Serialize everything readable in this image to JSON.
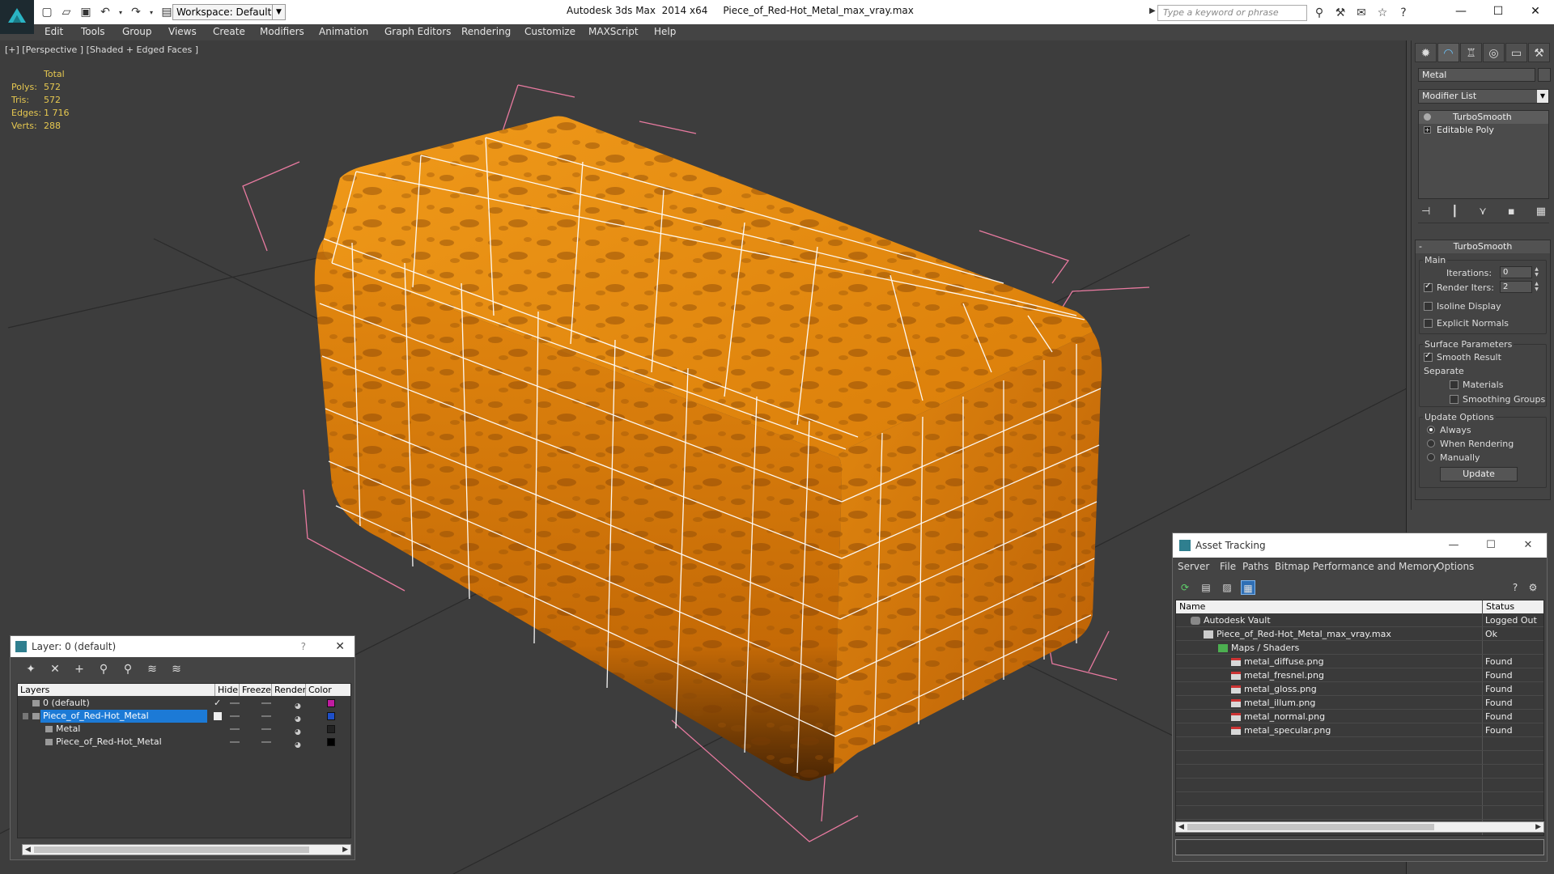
{
  "app": {
    "title": "Autodesk 3ds Max  2014 x64     Piece_of_Red-Hot_Metal_max_vray.max",
    "workspace": "Workspace: Default",
    "search_placeholder": "Type a keyword or phrase"
  },
  "menu": [
    "Edit",
    "Tools",
    "Group",
    "Views",
    "Create",
    "Modifiers",
    "Animation",
    "Graph Editors",
    "Rendering",
    "Customize",
    "MAXScript",
    "Help"
  ],
  "viewport": {
    "label": "[+] [Perspective ] [Shaded + Edged Faces ]",
    "stats": {
      "header": "Total",
      "polys_label": "Polys:",
      "polys": "572",
      "tris_label": "Tris:",
      "tris": "572",
      "edges_label": "Edges:",
      "edges": "1 716",
      "verts_label": "Verts:",
      "verts": "288"
    }
  },
  "command_panel": {
    "object_name": "Metal",
    "modifier_list": "Modifier List",
    "stack": [
      "TurboSmooth",
      "Editable Poly"
    ],
    "rollout_title": "TurboSmooth",
    "main_label": "Main",
    "iterations_label": "Iterations:",
    "iterations": "0",
    "render_iters_label": "Render Iters:",
    "render_iters": "2",
    "isoline": "Isoline Display",
    "explicit_normals": "Explicit Normals",
    "surface_params": "Surface Parameters",
    "smooth_result": "Smooth Result",
    "separate": "Separate",
    "materials": "Materials",
    "smoothing_groups": "Smoothing Groups",
    "update_options": "Update Options",
    "always": "Always",
    "when_rendering": "When Rendering",
    "manually": "Manually",
    "update_button": "Update"
  },
  "layer_window": {
    "title": "Layer: 0 (default)",
    "help": "?",
    "columns": {
      "layers": "Layers",
      "hide": "Hide",
      "freeze": "Freeze",
      "render": "Render",
      "color": "Color"
    },
    "rows": [
      {
        "name": "0 (default)",
        "color": "#c01ca0"
      },
      {
        "name": "Piece_of_Red-Hot_Metal",
        "color": "#1e4fc8"
      },
      {
        "name": "Metal",
        "color": "#222222"
      },
      {
        "name": "Piece_of_Red-Hot_Metal",
        "color": "#000000"
      }
    ]
  },
  "asset_window": {
    "title": "Asset Tracking",
    "menu": [
      "Server",
      "File",
      "Paths",
      "Bitmap Performance and Memory",
      "Options"
    ],
    "col_name": "Name",
    "col_status": "Status",
    "rows": [
      {
        "name": "Autodesk Vault",
        "status": "Logged Out"
      },
      {
        "name": "Piece_of_Red-Hot_Metal_max_vray.max",
        "status": "Ok"
      },
      {
        "name": "Maps / Shaders",
        "status": ""
      },
      {
        "name": "metal_diffuse.png",
        "status": "Found"
      },
      {
        "name": "metal_fresnel.png",
        "status": "Found"
      },
      {
        "name": "metal_gloss.png",
        "status": "Found"
      },
      {
        "name": "metal_illum.png",
        "status": "Found"
      },
      {
        "name": "metal_normal.png",
        "status": "Found"
      },
      {
        "name": "metal_specular.png",
        "status": "Found"
      }
    ]
  },
  "colors": {
    "accent": "#1c7ad6",
    "mesh_orange": "#e8860c",
    "stats_yellow": "#e6c850",
    "bbox_pink": "#e87aa0"
  }
}
